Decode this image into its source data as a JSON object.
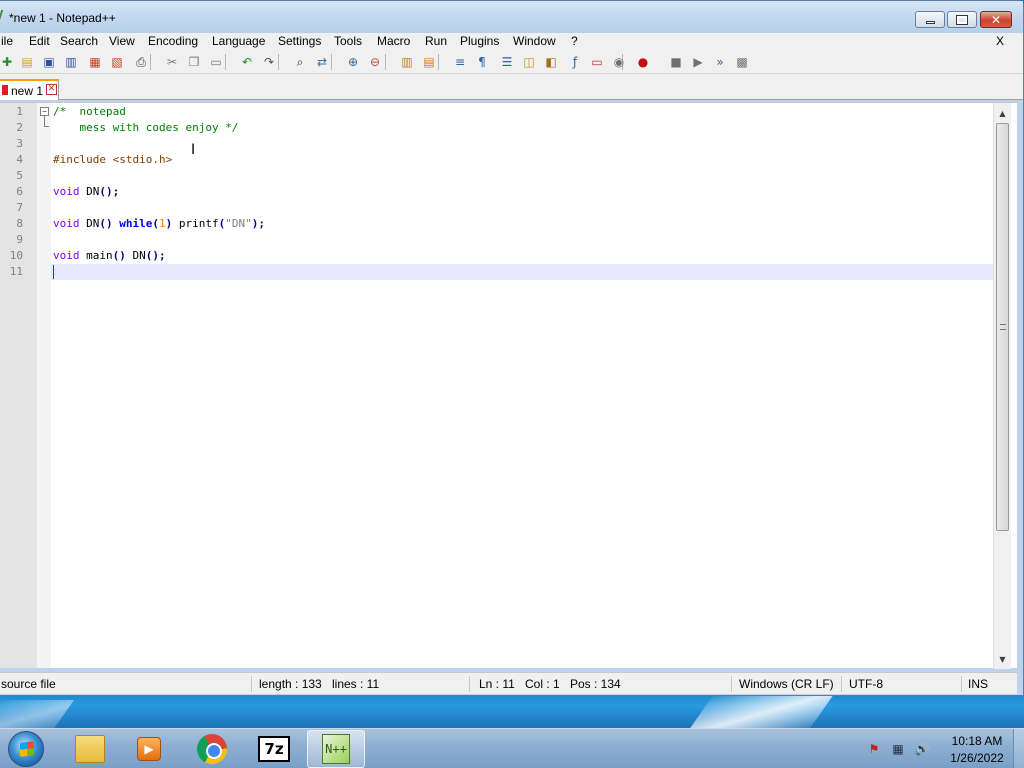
{
  "window": {
    "title": "*new 1 - Notepad++",
    "close_glyph": "✕"
  },
  "menu": {
    "items": [
      "ile",
      "Edit",
      "Search",
      "View",
      "Encoding",
      "Language",
      "Settings",
      "Tools",
      "Macro",
      "Run",
      "Plugins",
      "Window",
      "?"
    ],
    "close_label": "X"
  },
  "toolbar": {
    "icons": [
      "new-icon",
      "open-icon",
      "save-icon",
      "save-all-icon",
      "close-icon",
      "close-all-icon",
      "print-icon",
      "cut-icon",
      "copy-icon",
      "paste-icon",
      "undo-icon",
      "redo-icon",
      "find-icon",
      "replace-icon",
      "zoom-in-icon",
      "zoom-out-icon",
      "sync-v-icon",
      "sync-h-icon",
      "word-wrap-icon",
      "show-all-chars-icon",
      "indent-guide-icon",
      "udl-icon",
      "doc-map-icon",
      "function-list-icon",
      "folder-workspace-icon",
      "monitoring-icon",
      "record-macro-icon",
      "stop-macro-icon",
      "play-macro-icon",
      "run-macro-multiple-icon",
      "save-macro-icon"
    ]
  },
  "tabs": [
    {
      "label": "new 1",
      "close_glyph": "✕",
      "active": true
    }
  ],
  "editor": {
    "line_numbers": [
      "1",
      "2",
      "3",
      "4",
      "5",
      "6",
      "7",
      "8",
      "9",
      "10",
      "11"
    ],
    "lines": [
      [
        {
          "t": "/*  notepad",
          "c": "comment"
        }
      ],
      [
        {
          "t": "    mess with codes enjoy */",
          "c": "comment"
        }
      ],
      [],
      [
        {
          "t": "#include <stdio.h>",
          "c": "pre"
        }
      ],
      [],
      [
        {
          "t": "void",
          "c": "type"
        },
        {
          "t": " DN",
          "c": "id"
        },
        {
          "t": "();",
          "c": "op"
        }
      ],
      [],
      [
        {
          "t": "void",
          "c": "type"
        },
        {
          "t": " DN",
          "c": "id"
        },
        {
          "t": "() ",
          "c": "op"
        },
        {
          "t": "while",
          "c": "kw"
        },
        {
          "t": "(",
          "c": "op"
        },
        {
          "t": "1",
          "c": "num"
        },
        {
          "t": ") ",
          "c": "op"
        },
        {
          "t": "printf",
          "c": "id"
        },
        {
          "t": "(",
          "c": "op"
        },
        {
          "t": "\"DN\"",
          "c": "str"
        },
        {
          "t": ");",
          "c": "op"
        }
      ],
      [],
      [
        {
          "t": "void",
          "c": "type"
        },
        {
          "t": " main",
          "c": "id"
        },
        {
          "t": "() ",
          "c": "op"
        },
        {
          "t": "DN",
          "c": "id"
        },
        {
          "t": "();",
          "c": "op"
        }
      ],
      []
    ],
    "fold_glyph": "−",
    "text_cursor_glyph": "I"
  },
  "scrollbar": {
    "up_glyph": "▲",
    "down_glyph": "▼"
  },
  "status": {
    "file_type": "source file",
    "length": "length : 133",
    "lines": "lines : 11",
    "ln": "Ln : 11",
    "col": "Col : 1",
    "pos": "Pos : 134",
    "eol": "Windows (CR LF)",
    "encoding": "UTF-8",
    "mode": "INS"
  },
  "taskbar": {
    "apps": [
      "file-explorer-icon",
      "media-player-icon",
      "chrome-icon",
      "7zip-icon",
      "notepadpp-icon"
    ],
    "sevenzip_label": "7z",
    "media_glyph": "▶",
    "npp_glyph": "N++",
    "tray_flag_glyph": "⚑",
    "tray_network_glyph": "▦",
    "tray_volume_glyph": "🔊",
    "time": "10:18 AM",
    "date": "1/26/2022"
  },
  "colors": {
    "accent_tab": "#f5a000",
    "current_line": "#e8e8ff",
    "comment": "#008000",
    "keyword": "#0000ff",
    "type": "#8000ff"
  }
}
